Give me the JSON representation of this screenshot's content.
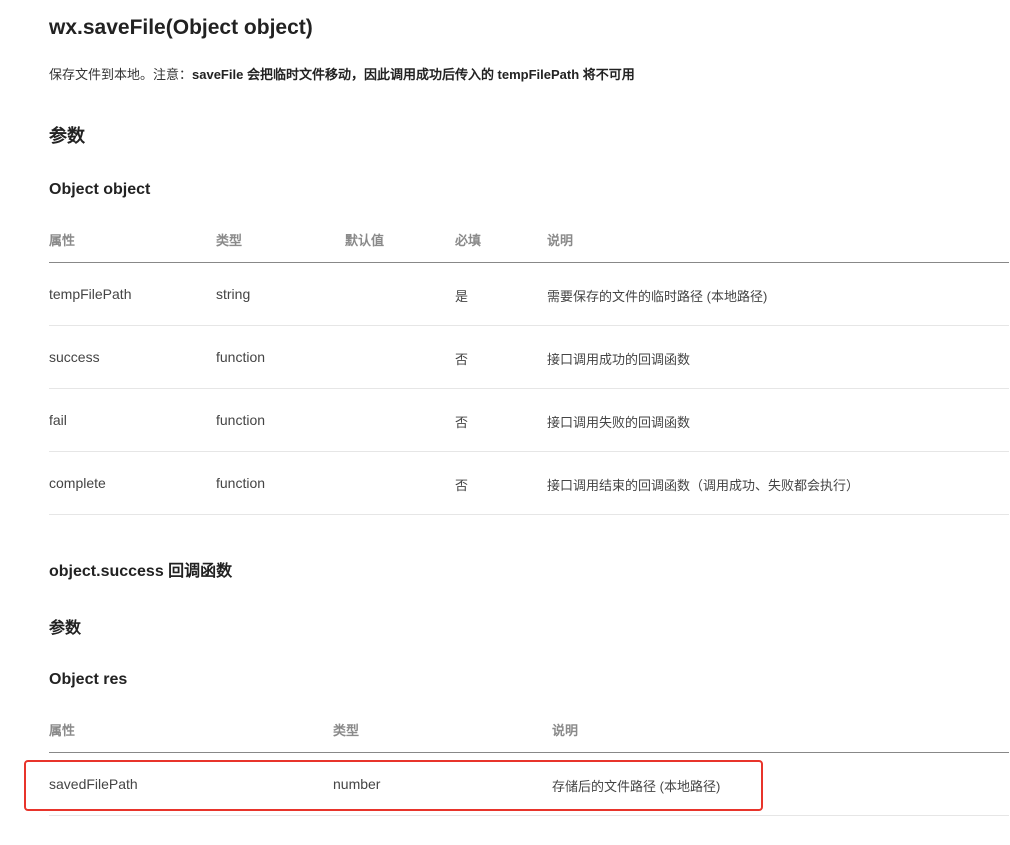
{
  "doc": {
    "title": "wx.saveFile(Object object)",
    "desc_prefix": "保存文件到本地。注意：",
    "desc_bold": "saveFile 会把临时文件移动，因此调用成功后传入的 tempFilePath 将不可用",
    "params_heading": "参数",
    "object_heading": "Object object"
  },
  "params_table": {
    "headers": [
      "属性",
      "类型",
      "默认值",
      "必填",
      "说明"
    ],
    "rows": [
      [
        "tempFilePath",
        "string",
        "",
        "是",
        "需要保存的文件的临时路径 (本地路径)"
      ],
      [
        "success",
        "function",
        "",
        "否",
        "接口调用成功的回调函数"
      ],
      [
        "fail",
        "function",
        "",
        "否",
        "接口调用失败的回调函数"
      ],
      [
        "complete",
        "function",
        "",
        "否",
        "接口调用结束的回调函数（调用成功、失败都会执行）"
      ]
    ]
  },
  "success_section": {
    "heading": "object.success 回调函数",
    "params_heading": "参数",
    "res_heading": "Object res"
  },
  "res_table": {
    "headers": [
      "属性",
      "类型",
      "说明"
    ],
    "rows": [
      [
        "savedFilePath",
        "number",
        "存储后的文件路径 (本地路径)"
      ]
    ]
  },
  "colors": {
    "highlight_border": "#e8342b",
    "header_text": "#8a8a8a",
    "body_text": "#444444"
  }
}
